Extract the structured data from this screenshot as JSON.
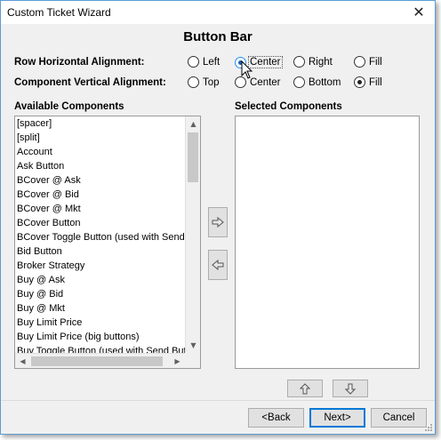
{
  "window": {
    "title": "Custom Ticket Wizard",
    "close_glyph": "✕"
  },
  "heading": "Button Bar",
  "row_alignment": {
    "label": "Row Horizontal Alignment:",
    "options": [
      "Left",
      "Center",
      "Right",
      "Fill"
    ],
    "selected": "Center"
  },
  "vertical_alignment": {
    "label": "Component Vertical Alignment:",
    "options": [
      "Top",
      "Center",
      "Bottom",
      "Fill"
    ],
    "selected": "Fill"
  },
  "available": {
    "label": "Available Components",
    "items": [
      "[spacer]",
      "[split]",
      "Account",
      "Ask Button",
      "BCover @ Ask",
      "BCover @ Bid",
      "BCover @ Mkt",
      "BCover Button",
      "BCover Toggle Button (used with Send B",
      "Bid Button",
      "Broker Strategy",
      "Buy @ Ask",
      "Buy @ Bid",
      "Buy @ Mkt",
      "Buy Limit Price",
      "Buy Limit Price (big buttons)",
      "Buy Toggle Button (used with Send Butt"
    ]
  },
  "selected": {
    "label": "Selected Components",
    "items": []
  },
  "icons": {
    "add": "arrow-right-icon",
    "remove": "arrow-left-icon",
    "up": "arrow-up-icon",
    "down": "arrow-down-icon"
  },
  "footer": {
    "back_label": "<Back",
    "next_label": "Next>",
    "cancel_label": "Cancel"
  },
  "colors": {
    "accent": "#0078d7",
    "border": "#5b9bd5"
  }
}
